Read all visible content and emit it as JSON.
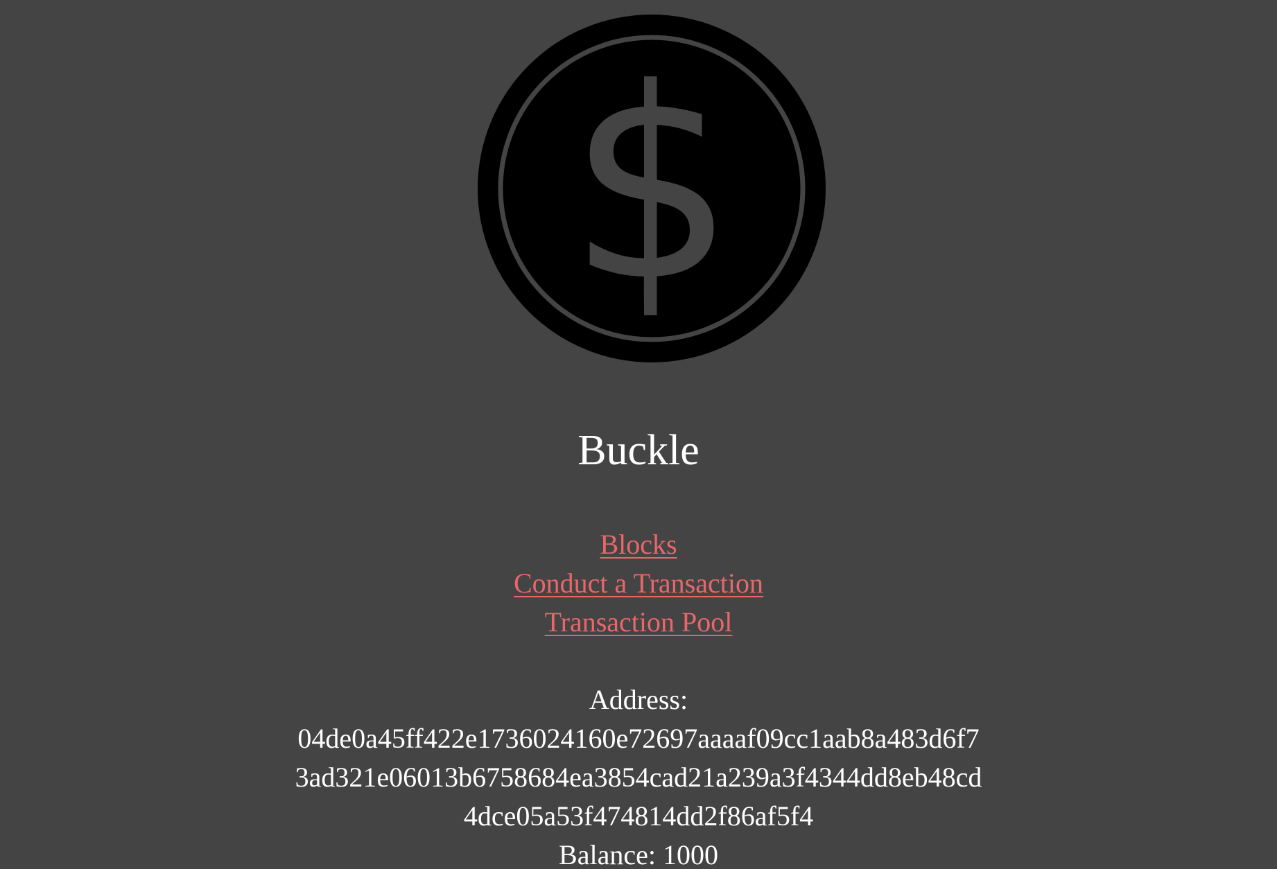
{
  "logo": {
    "icon": "dollar-coin-icon",
    "glyph": "$",
    "coin_color": "#000000",
    "ring_color": "#444444"
  },
  "site": {
    "title": "Buckle"
  },
  "nav": {
    "blocks": "Blocks",
    "conduct_transaction": "Conduct a Transaction",
    "transaction_pool": "Transaction Pool",
    "link_color": "#e8676b"
  },
  "wallet": {
    "address_label": "Address:",
    "address_lines": [
      "04de0a45ff422e1736024160e72697aaaaf09cc1aab8a483d6f7",
      "3ad321e06013b6758684ea3854cad21a239a3f4344dd8eb48cd",
      "4dce05a53f474814dd2f86af5f4"
    ],
    "balance_label": "Balance:",
    "balance_value": "1000"
  },
  "colors": {
    "background": "#444444",
    "text": "#ffffff"
  }
}
